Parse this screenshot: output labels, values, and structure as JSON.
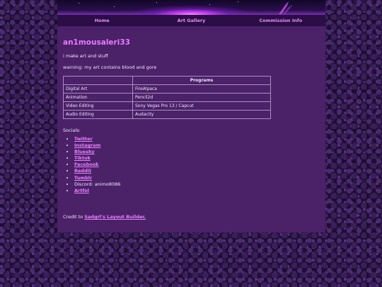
{
  "nav": {
    "items": [
      {
        "label": "Home"
      },
      {
        "label": "Art Gallery"
      },
      {
        "label": "Commission Info"
      }
    ]
  },
  "profile": {
    "username": "an1mousaleri33",
    "bio": "i make art and stuff",
    "warning": "warning: my art contains blood and gore"
  },
  "programs": {
    "header": "Programs",
    "rows": [
      {
        "category": "Digital Art",
        "program": "FireAlpaca"
      },
      {
        "category": "Animation",
        "program": "Pencil2d"
      },
      {
        "category": "Video Editing",
        "program": "Sony Vegas Pro 13 / Capcut"
      },
      {
        "category": "Audio Editing",
        "program": "Audacity"
      }
    ]
  },
  "socials": {
    "heading": "Socials:",
    "links": [
      "Twitter",
      "Instagram",
      "Bluesky",
      "Tiktok",
      "Facebook",
      "Reddit",
      "Tumblr"
    ],
    "discord": "Discord: animo8086",
    "last_link": "Artfol"
  },
  "footer": {
    "credit_prefix": "Credit to ",
    "credit_link": "Sadgrl's Layout Builder."
  },
  "colors": {
    "background": "#1c0f2e",
    "container": "#4b2168",
    "nav_bar": "#2a0e45",
    "accent": "#e87bff",
    "text": "#f2e6ff"
  }
}
